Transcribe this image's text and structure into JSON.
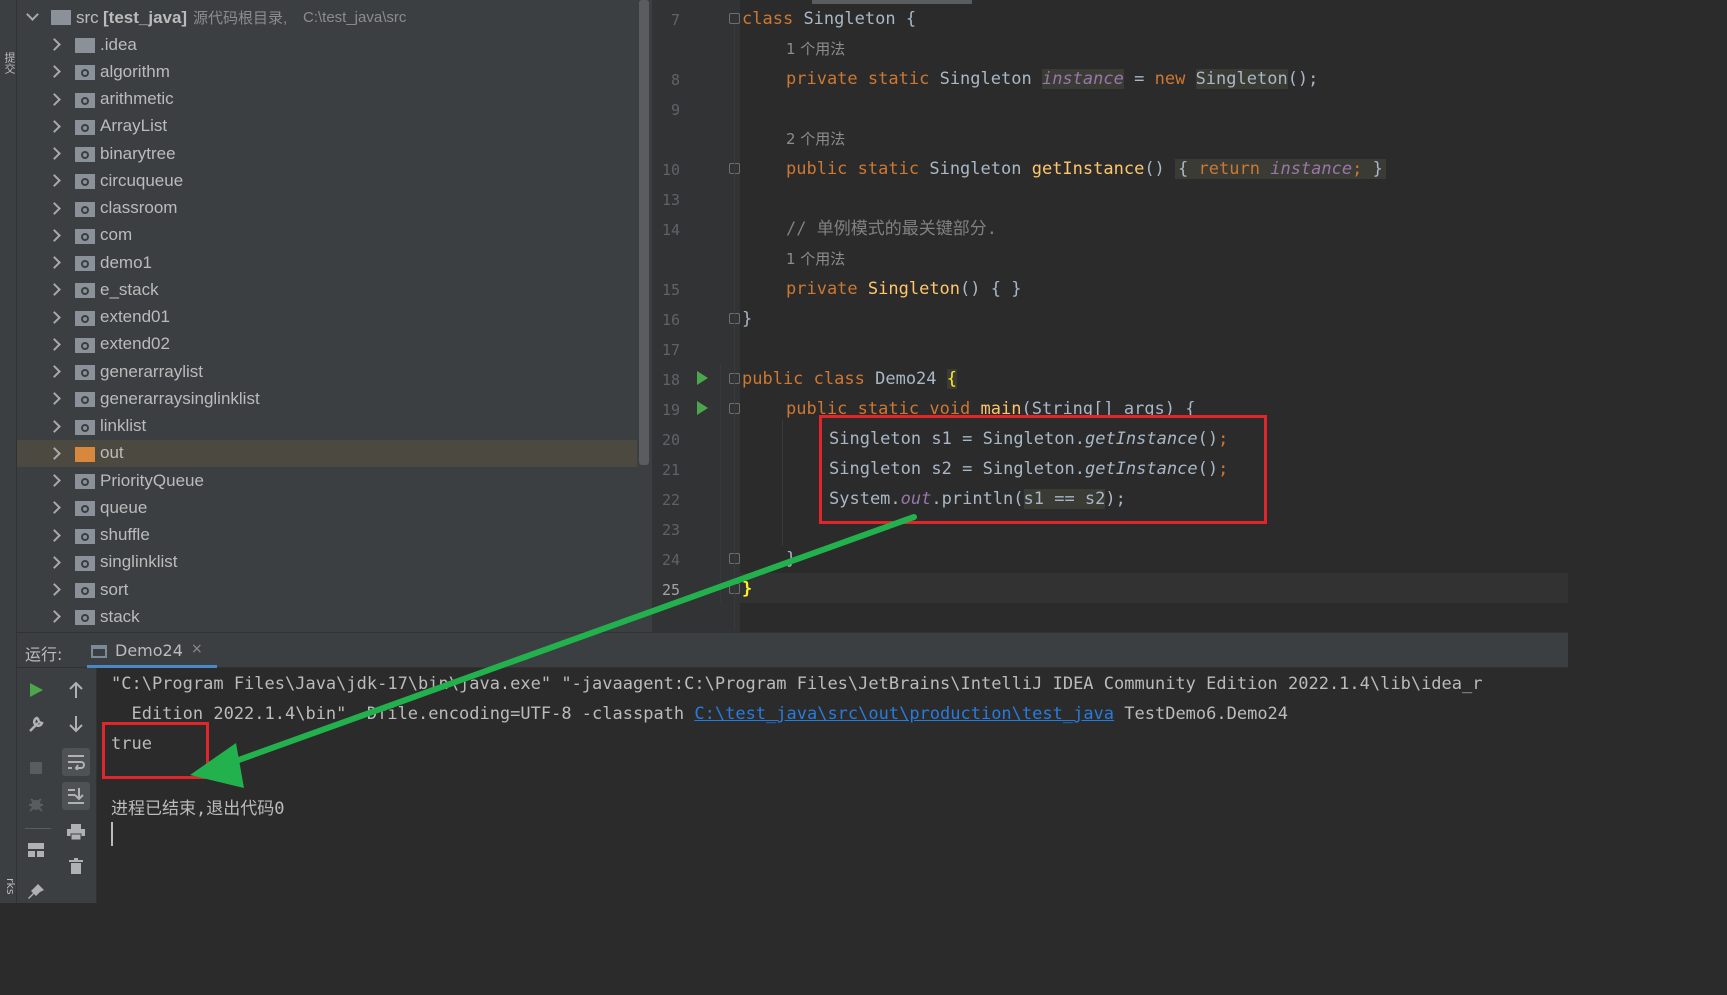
{
  "left_strip": {
    "labels": [
      "提交",
      "rks"
    ]
  },
  "project_tree": {
    "root": {
      "name": "src",
      "module": "[test_java]",
      "hint": "源代码根目录,",
      "path": "C:\\test_java\\src"
    },
    "items": [
      {
        "label": ".idea",
        "icon": "folder-icon"
      },
      {
        "label": "algorithm",
        "icon": "package-icon"
      },
      {
        "label": "arithmetic",
        "icon": "package-icon"
      },
      {
        "label": "ArrayList",
        "icon": "package-icon"
      },
      {
        "label": "binarytree",
        "icon": "package-icon"
      },
      {
        "label": "circuqueue",
        "icon": "package-icon"
      },
      {
        "label": "classroom",
        "icon": "package-icon"
      },
      {
        "label": "com",
        "icon": "package-icon"
      },
      {
        "label": "demo1",
        "icon": "package-icon"
      },
      {
        "label": "e_stack",
        "icon": "package-icon"
      },
      {
        "label": "extend01",
        "icon": "package-icon"
      },
      {
        "label": "extend02",
        "icon": "package-icon"
      },
      {
        "label": "generarraylist",
        "icon": "package-icon"
      },
      {
        "label": "generarraysinglinklist",
        "icon": "package-icon"
      },
      {
        "label": "linklist",
        "icon": "package-icon"
      },
      {
        "label": "out",
        "icon": "excluded-folder-icon"
      },
      {
        "label": "PriorityQueue",
        "icon": "package-icon"
      },
      {
        "label": "queue",
        "icon": "package-icon"
      },
      {
        "label": "shuffle",
        "icon": "package-icon"
      },
      {
        "label": "singlinklist",
        "icon": "package-icon"
      },
      {
        "label": "sort",
        "icon": "package-icon"
      },
      {
        "label": "stack",
        "icon": "package-icon"
      }
    ],
    "selected": "out"
  },
  "editor": {
    "line_numbers": [
      "7",
      "8",
      "9",
      "10",
      "13",
      "14",
      "15",
      "16",
      "17",
      "18",
      "19",
      "20",
      "21",
      "22",
      "23",
      "24",
      "25"
    ],
    "current_line": "25",
    "usage_hints": [
      "1 个用法",
      "2 个用法",
      "1 个用法"
    ],
    "tokens": {
      "class_kw": "class",
      "singleton": "Singleton",
      "brace_open": "{",
      "brace_close": "}",
      "private_kw": "private",
      "static_kw": "static",
      "public_kw": "public",
      "void_kw": "void",
      "new_kw": "new",
      "return_kw": "return",
      "instance": "instance",
      "eq": "=",
      "call_parens_semi": "();",
      "get_instance": "getInstance",
      "parens": "()",
      "semi": ";",
      "comment": "// 单例模式的最关键部分.",
      "demo_class": "Demo24",
      "main": "main",
      "main_params": "(String[] args) {",
      "s1": "s1",
      "s2": "s2",
      "dot": ".",
      "system": "System",
      "out": "out",
      "println_open": ".println(",
      "compare": "s1 == s2",
      "close_semi": ");",
      "empty_body": "() { }"
    }
  },
  "run_panel": {
    "label": "运行:",
    "tab_label": "Demo24",
    "tab_close": "×",
    "console": {
      "line1": "\"C:\\Program Files\\Java\\jdk-17\\bin\\java.exe\" \"-javaagent:C:\\Program Files\\JetBrains\\IntelliJ IDEA Community Edition 2022.1.4\\lib\\idea_r",
      "line2_prefix": "  Edition 2022.1.4\\bin\" -Dfile.encoding=UTF-8 -classpath ",
      "line2_link": "C:\\test_java\\src\\out\\production\\test_java",
      "line2_suffix": " TestDemo6.Demo24",
      "output": "true",
      "exit_message": "进程已结束,退出代码0"
    }
  },
  "annotation_colors": {
    "box": "#e0262a",
    "arrow": "#22b14c"
  }
}
